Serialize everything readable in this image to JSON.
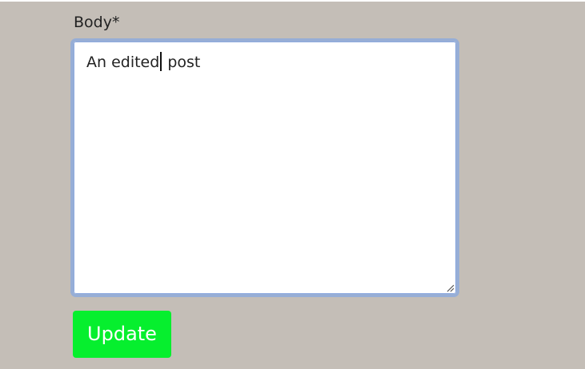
{
  "form": {
    "body_label": "Body*",
    "body_text_before_caret": "An edited",
    "body_text_after_caret": " post",
    "update_button_label": "Update"
  },
  "colors": {
    "page_background": "#c4beb7",
    "field_border": "#97aed6",
    "button_background": "#06ef2e",
    "button_text": "#ffffff"
  },
  "icons": {
    "resize_handle": "resize-grip-icon"
  }
}
